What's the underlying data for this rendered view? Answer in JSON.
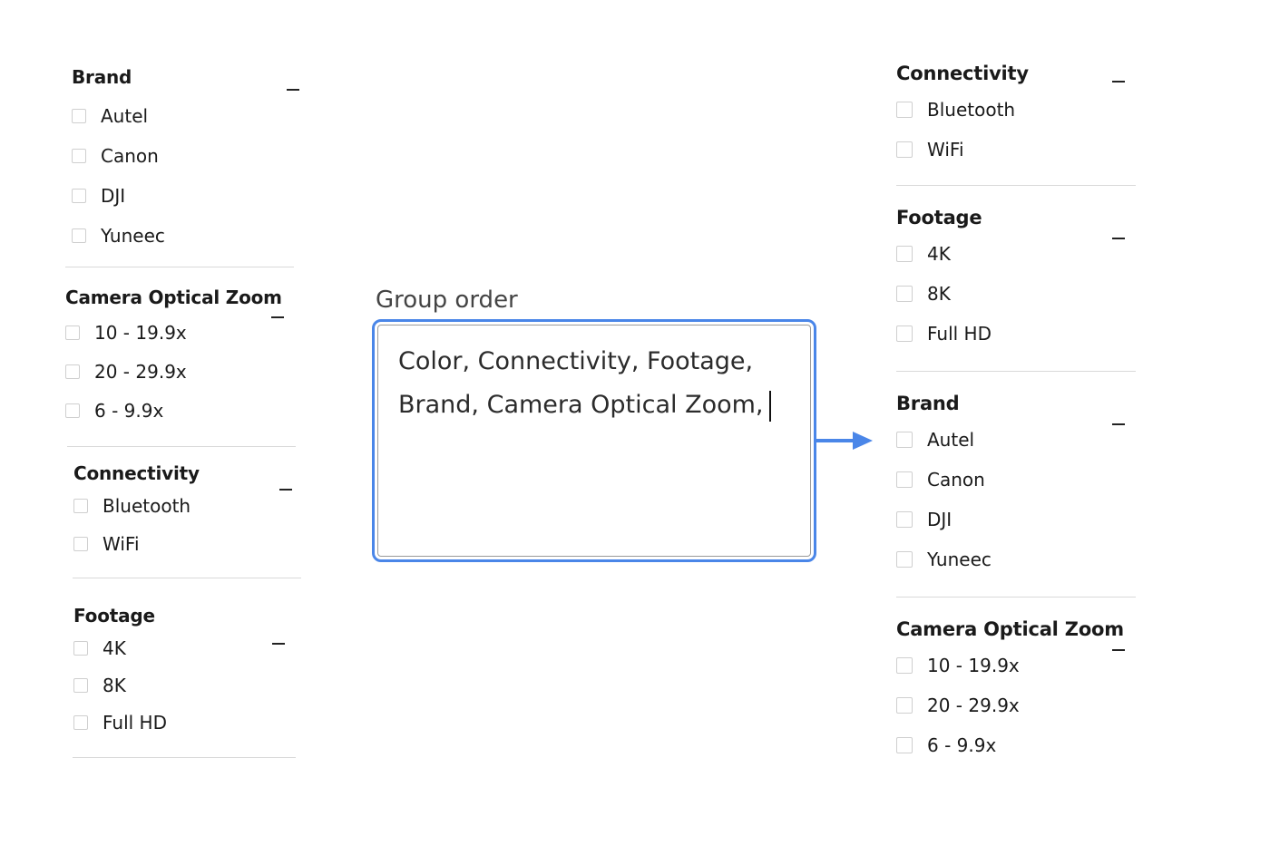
{
  "left_filters": {
    "groups": [
      {
        "title": "Brand",
        "options": [
          "Autel",
          "Canon",
          "DJI",
          "Yuneec"
        ]
      },
      {
        "title": "Camera Optical Zoom",
        "options": [
          "10 - 19.9x",
          "20 - 29.9x",
          "6 - 9.9x"
        ]
      },
      {
        "title": "Connectivity",
        "options": [
          "Bluetooth",
          "WiFi"
        ]
      },
      {
        "title": "Footage",
        "options": [
          "4K",
          "8K",
          "Full HD"
        ]
      }
    ]
  },
  "group_order": {
    "label": "Group order",
    "value_line1": "Color, Connectivity, Footage,",
    "value_line2": "Brand, Camera Optical Zoom,"
  },
  "right_filters": {
    "groups": [
      {
        "title": "Connectivity",
        "options": [
          "Bluetooth",
          "WiFi"
        ]
      },
      {
        "title": "Footage",
        "options": [
          "4K",
          "8K",
          "Full HD"
        ]
      },
      {
        "title": "Brand",
        "options": [
          "Autel",
          "Canon",
          "DJI",
          "Yuneec"
        ]
      },
      {
        "title": "Camera Optical Zoom",
        "options": [
          "10 - 19.9x",
          "20 - 29.9x",
          "6 - 9.9x"
        ]
      }
    ]
  },
  "colors": {
    "accent": "#4a86e8",
    "divider": "#d9d9d9",
    "checkbox_border": "#cfcfcf"
  },
  "icons": {
    "collapse": "minus-icon",
    "arrow": "arrow-right-icon"
  }
}
